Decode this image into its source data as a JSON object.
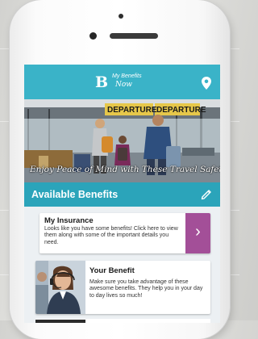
{
  "app": {
    "logo_letter": "B",
    "logo_line1": "My Benefits",
    "logo_line2": "Now"
  },
  "hero": {
    "sign_text": "DEPARTURE",
    "caption": "Enjoy Peace of Mind with These Travel Safety Tips"
  },
  "section": {
    "title": "Available Benefits"
  },
  "cards": [
    {
      "title": "My Insurance",
      "body": "Looks like you have some benefits! Click here to view them along with some of the important details you need.",
      "arrow": "›"
    },
    {
      "title": "Your Benefit",
      "body": "Make sure you take advantage of these awesome benefits. They help you in your day to day lives so much!"
    }
  ],
  "colors": {
    "header": "#3ab3c8",
    "section_bar": "#2ba4ba",
    "arrow_button": "#a34f98"
  },
  "icons": {
    "location": "location-pin-icon",
    "edit": "pencil-icon",
    "arrow": "chevron-right-icon"
  }
}
